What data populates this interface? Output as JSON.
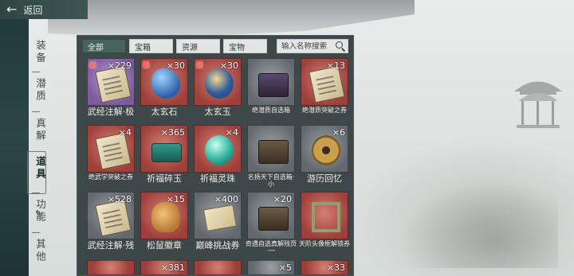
{
  "header": {
    "back_label": "返回"
  },
  "side_nav": {
    "items": [
      {
        "label": "装备",
        "active": false
      },
      {
        "label": "潜质",
        "active": false
      },
      {
        "label": "真解",
        "active": false
      },
      {
        "label": "道具",
        "active": true
      },
      {
        "label": "功能",
        "active": false
      },
      {
        "label": "其他",
        "active": false
      }
    ]
  },
  "tabs": [
    {
      "label": "全部",
      "active": true
    },
    {
      "label": "宝箱",
      "active": false
    },
    {
      "label": "资源",
      "active": false
    },
    {
      "label": "宝物",
      "active": false
    }
  ],
  "search": {
    "placeholder": "输入名称搜索"
  },
  "items": [
    {
      "name": "武经注解·极",
      "count": "×229",
      "new": "新",
      "quality": "purple",
      "icon": "scroll-icon",
      "small": false
    },
    {
      "name": "太玄石",
      "count": "×30",
      "new": "新",
      "quality": "red",
      "icon": "stone-icon",
      "small": false
    },
    {
      "name": "太玄玉",
      "count": "×30",
      "new": "新",
      "quality": "red",
      "icon": "jade-icon",
      "small": false
    },
    {
      "name": "绝潜质自选箱",
      "count": "",
      "new": "",
      "quality": "gray",
      "icon": "chest-icon",
      "small": true
    },
    {
      "name": "绝潜质突破之券",
      "count": "×13",
      "new": "",
      "quality": "red",
      "icon": "scroll-icon",
      "small": true
    },
    {
      "name": "绝武学突破之券",
      "count": "×4",
      "new": "",
      "quality": "red",
      "icon": "scroll-icon",
      "small": true
    },
    {
      "name": "祈福碎玉",
      "count": "×365",
      "new": "",
      "quality": "red",
      "icon": "beads-icon",
      "small": false
    },
    {
      "name": "祈福灵珠",
      "count": "×4",
      "new": "",
      "quality": "red",
      "icon": "orb-icon",
      "small": false
    },
    {
      "name": "名扬天下自选箱·小",
      "count": "",
      "new": "",
      "quality": "gray",
      "icon": "chest-icon",
      "small": true
    },
    {
      "name": "游历回忆",
      "count": "×6",
      "new": "",
      "quality": "gray",
      "icon": "coin-icon",
      "small": false
    },
    {
      "name": "武经注解·残",
      "count": "×528",
      "new": "",
      "quality": "gray",
      "icon": "scroll-icon",
      "small": false
    },
    {
      "name": "松鼠徽章",
      "count": "×15",
      "new": "",
      "quality": "red",
      "icon": "squirrel-icon",
      "small": false
    },
    {
      "name": "巅峰挑战券",
      "count": "×400",
      "new": "",
      "quality": "gray",
      "icon": "ticket-icon",
      "small": false
    },
    {
      "name": "奇遇自选真解残页·一",
      "count": "×20",
      "new": "",
      "quality": "gray",
      "icon": "chest-icon",
      "small": true
    },
    {
      "name": "天阶头像框解锁券",
      "count": "",
      "new": "",
      "quality": "red",
      "icon": "frame-icon",
      "small": true
    }
  ],
  "peek_row": [
    {
      "count": "",
      "quality": "red"
    },
    {
      "count": "×381",
      "quality": "red"
    },
    {
      "count": "",
      "quality": "red"
    },
    {
      "count": "×5",
      "quality": "gray"
    },
    {
      "count": "×33",
      "quality": "red"
    }
  ]
}
